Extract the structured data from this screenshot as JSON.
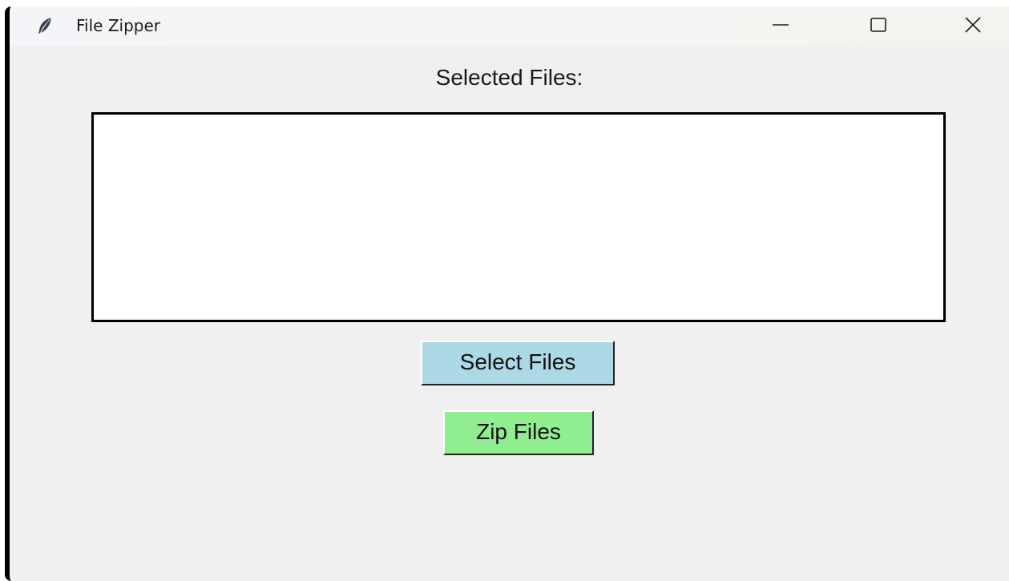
{
  "window": {
    "title": "File Zipper",
    "app_icon": "feather-icon",
    "controls": {
      "minimize_icon": "minimize-icon",
      "maximize_icon": "maximize-icon",
      "close_icon": "close-icon"
    }
  },
  "main": {
    "selected_label": "Selected Files:",
    "files": [],
    "select_button_label": "Select Files",
    "zip_button_label": "Zip Files"
  },
  "colors": {
    "window_bg": "#f0f0f0",
    "listbox_bg": "#ffffff",
    "select_button_bg": "#add8e6",
    "zip_button_bg": "#90ee90"
  }
}
